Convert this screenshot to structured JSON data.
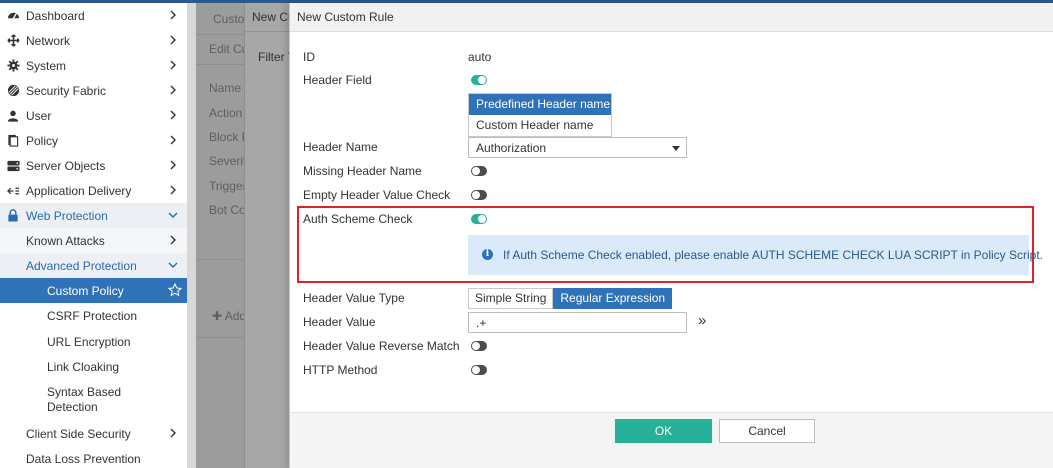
{
  "sidebar": {
    "items": [
      {
        "label": "Dashboard",
        "icon": "dashboard-icon"
      },
      {
        "label": "Network",
        "icon": "network-icon"
      },
      {
        "label": "System",
        "icon": "gear-icon"
      },
      {
        "label": "Security Fabric",
        "icon": "security-fabric-icon"
      },
      {
        "label": "User",
        "icon": "user-icon"
      },
      {
        "label": "Policy",
        "icon": "policy-icon"
      },
      {
        "label": "Server Objects",
        "icon": "server-icon"
      },
      {
        "label": "Application Delivery",
        "icon": "application-delivery-icon"
      },
      {
        "label": "Web Protection",
        "icon": "lock-icon"
      },
      {
        "label": "Known Attacks"
      },
      {
        "label": "Advanced Protection"
      },
      {
        "label": "Custom Policy"
      },
      {
        "label": "CSRF Protection"
      },
      {
        "label": "URL Encryption"
      },
      {
        "label": "Link Cloaking"
      },
      {
        "label": "Syntax Based Detection"
      },
      {
        "label": "Client Side Security"
      },
      {
        "label": "Data Loss Prevention"
      }
    ]
  },
  "background": {
    "tab_label": "Custo",
    "panel_title": "New Cu",
    "edit_label": "Edit Cu",
    "filter_label": "Filter T",
    "fields": [
      "Name",
      "Action",
      "Block P",
      "Severit",
      "Trigger",
      "Bot Co"
    ],
    "add_label": "Add"
  },
  "modal": {
    "title": "New Custom Rule",
    "id_label": "ID",
    "id_value": "auto",
    "header_field_label": "Header Field",
    "header_field_options": [
      "Predefined Header name",
      "Custom Header name"
    ],
    "header_name_label": "Header Name",
    "header_name_value": "Authorization",
    "missing_header_label": "Missing Header Name",
    "empty_header_label": "Empty Header Value Check",
    "auth_scheme_label": "Auth Scheme Check",
    "info_icon": "info-icon",
    "info_text": "If Auth Scheme Check enabled, please enable AUTH SCHEME CHECK LUA SCRIPT in Policy Script.",
    "header_value_type_label": "Header Value Type",
    "header_value_type_options": [
      "Simple String",
      "Regular Expression"
    ],
    "header_value_label": "Header Value",
    "header_value": ".+",
    "reverse_match_label": "Header Value Reverse Match",
    "http_method_label": "HTTP Method",
    "ok_label": "OK",
    "cancel_label": "Cancel"
  },
  "colors": {
    "accent": "#2f72b8",
    "toggle_on": "#26b196",
    "ok_button": "#26b196",
    "highlight_border": "#d9232a",
    "info_bg": "#dbeaf8"
  }
}
